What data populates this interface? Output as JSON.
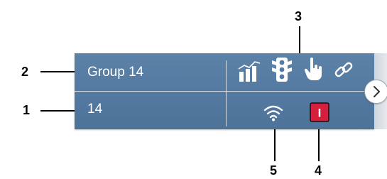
{
  "group_tile": {
    "name": "Group 14",
    "id": "14",
    "status_icons": {
      "chart": "chart-icon",
      "traffic_light": "traffic-light-icon",
      "hand_pointer": "hand-pointer-icon",
      "link": "link-icon",
      "wifi": "wifi-icon",
      "alert_badge": "alert-badge-icon",
      "alert_badge_text": "I"
    },
    "next_button_icon": "chevron-right-icon"
  },
  "callouts": [
    "1",
    "2",
    "3",
    "4",
    "5"
  ],
  "colors": {
    "tile": "#557ba2",
    "alert_badge": "#d61f3c",
    "text": "#ffffff"
  }
}
